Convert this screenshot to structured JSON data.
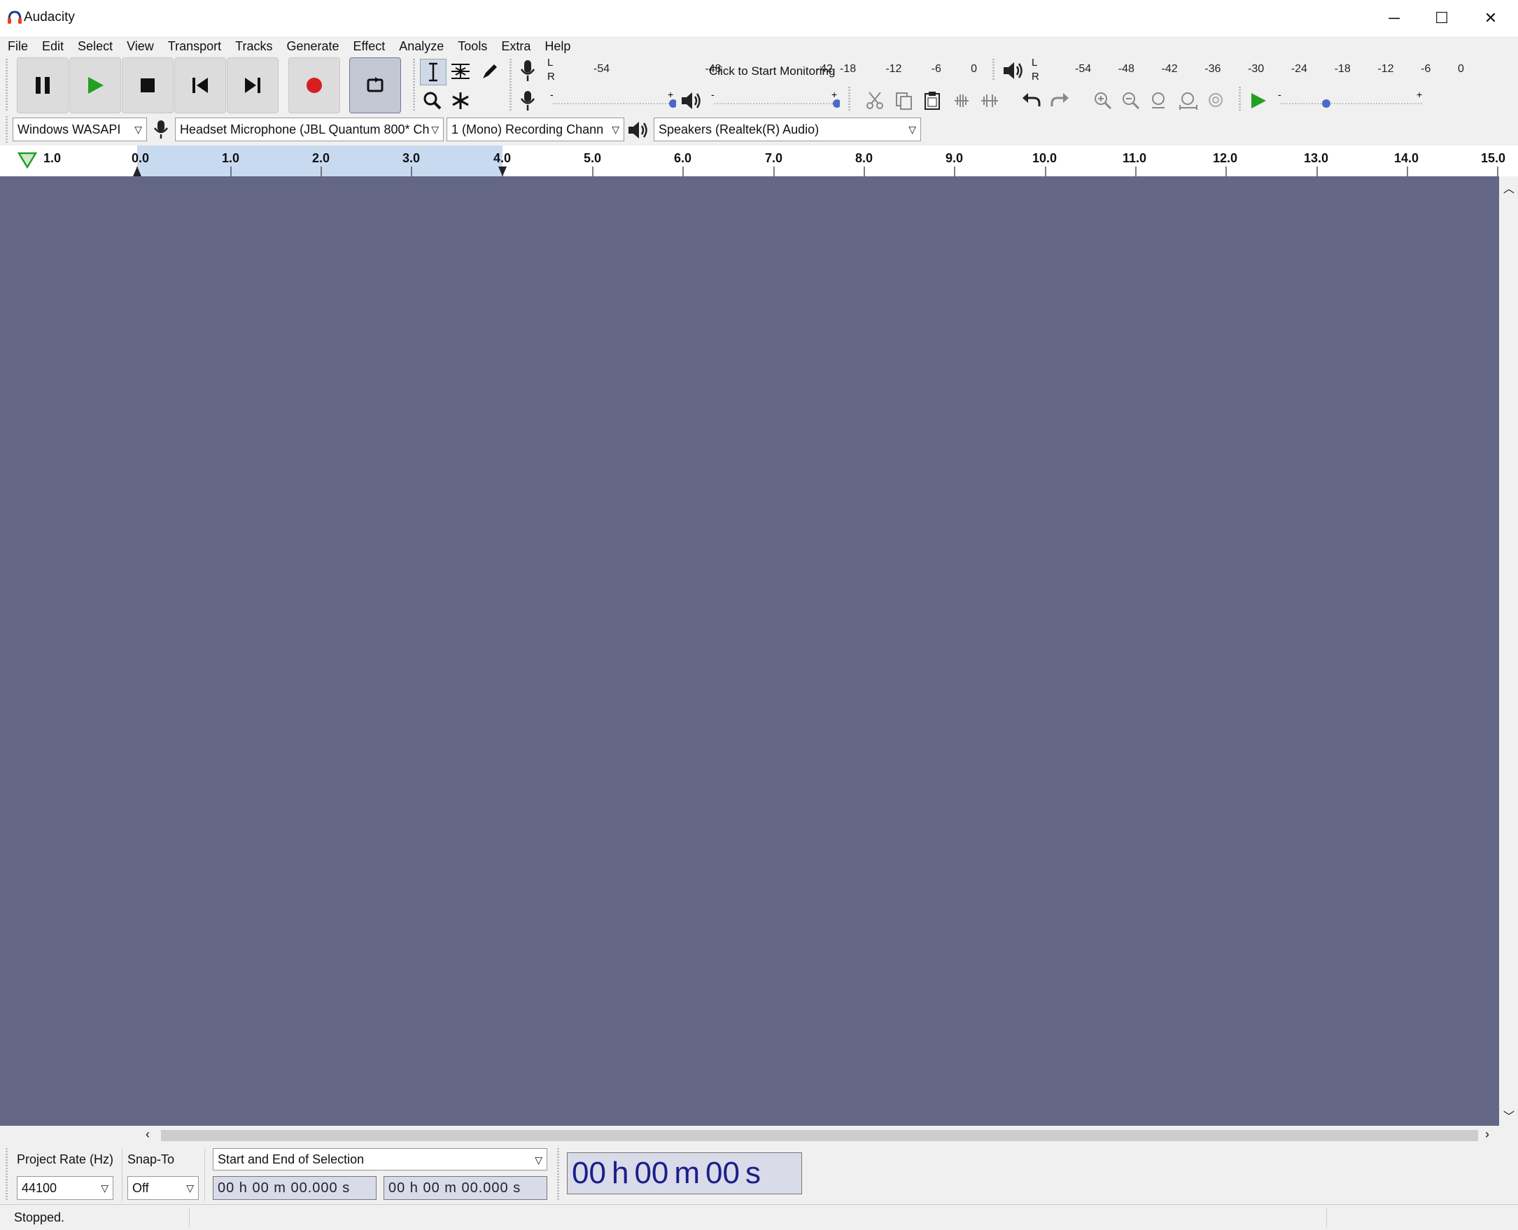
{
  "window": {
    "title": "Audacity",
    "minimize": "─",
    "maximize": "☐",
    "close": "✕"
  },
  "menu": [
    "File",
    "Edit",
    "Select",
    "View",
    "Transport",
    "Tracks",
    "Generate",
    "Effect",
    "Analyze",
    "Tools",
    "Extra",
    "Help"
  ],
  "meters": {
    "record_scale": [
      "-54",
      "-48",
      "-42"
    ],
    "monitor_label": "Click to Start Monitoring",
    "record_scale_right": [
      "-18",
      "-12",
      "-6",
      "0"
    ],
    "playback_scale": [
      "-54",
      "-48",
      "-42",
      "-36",
      "-30",
      "-24",
      "-18",
      "-12",
      "-6",
      "0"
    ],
    "lr": [
      "L",
      "R"
    ]
  },
  "devices": {
    "host": "Windows WASAPI",
    "mic": "Headset Microphone (JBL Quantum 800* Ch",
    "channels": "1 (Mono) Recording Chann­",
    "speaker": "Speakers (Realtek(R) Audio)"
  },
  "ruler": {
    "labels": [
      "1.0",
      "0.0",
      "1.0",
      "2.0",
      "3.0",
      "4.0",
      "5.0",
      "6.0",
      "7.0",
      "8.0",
      "9.0",
      "10.0",
      "11.0",
      "12.0",
      "13.0",
      "14.0",
      "15.0"
    ]
  },
  "bottom": {
    "project_rate_label": "Project Rate (Hz)",
    "project_rate_value": "44100",
    "snap_to_label": "Snap-To",
    "snap_to_value": "Off",
    "selection_mode": "Start and End of Selection",
    "sel_start": "00 h 00 m 00.000 s",
    "sel_end": "00 h 00 m 00.000 s",
    "big_time": [
      "00",
      "h",
      "00",
      "m",
      "00",
      "s"
    ]
  },
  "status": {
    "text": "Stopped."
  },
  "colors": {
    "track_bg": "#646685",
    "selection": "#c8daf0",
    "record_red": "#d62020",
    "play_green": "#22a022"
  }
}
